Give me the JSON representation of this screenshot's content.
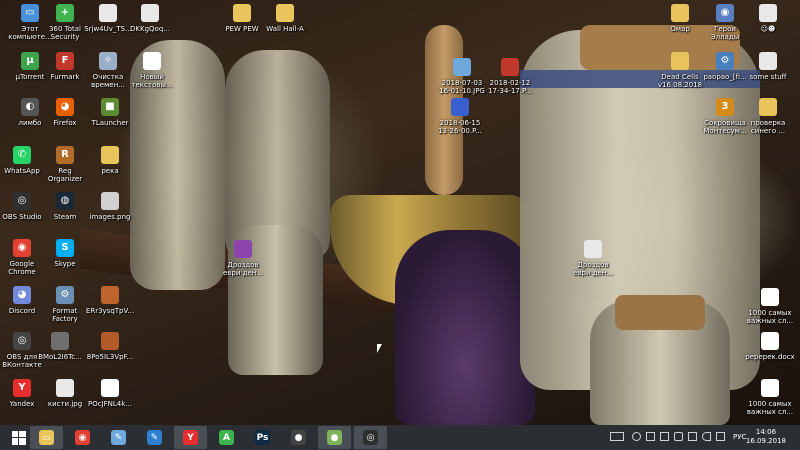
{
  "desktop_icons": [
    {
      "id": "computer",
      "label": "Этот\nкомпьюте...",
      "icon": "computer-icon",
      "color": "#4a90d9",
      "glyph": "▭"
    },
    {
      "id": "360",
      "label": "360 Total\nSecurity",
      "icon": "shield-icon",
      "color": "#3fb34f",
      "glyph": "+"
    },
    {
      "id": "srjw",
      "label": "Srjw4Uv_TS...",
      "icon": "document-icon",
      "color": "#e8e8e8",
      "glyph": ""
    },
    {
      "id": "dkkg",
      "label": "DKKgQoq...",
      "icon": "document-icon",
      "color": "#e8e8e8",
      "glyph": ""
    },
    {
      "id": "pewpew",
      "label": "PEW PEW",
      "icon": "folder-icon",
      "color": "#e8c45a",
      "glyph": ""
    },
    {
      "id": "wallhall",
      "label": "Wall Hall-A",
      "icon": "folder-icon",
      "color": "#e8c45a",
      "glyph": ""
    },
    {
      "id": "omar",
      "label": "Омар",
      "icon": "folder-icon",
      "color": "#e8c45a",
      "glyph": ""
    },
    {
      "id": "heroes",
      "label": "Герои\nЭллады",
      "icon": "game-icon",
      "color": "#5a7fc0",
      "glyph": "◉"
    },
    {
      "id": "smile",
      "label": "☺☻",
      "icon": "document-icon",
      "color": "#e8e8e8",
      "glyph": ""
    },
    {
      "id": "utorrent",
      "label": "µTorrent",
      "icon": "utorrent-icon",
      "color": "#3fa34d",
      "glyph": "µ"
    },
    {
      "id": "furmark",
      "label": "Furmark",
      "icon": "furmark-icon",
      "color": "#c0392b",
      "glyph": "F"
    },
    {
      "id": "cleaner",
      "label": "Очистка\nвремен...",
      "icon": "cleanup-icon",
      "color": "#9ab0c8",
      "glyph": "✧"
    },
    {
      "id": "newtext",
      "label": "Новый\nтекстовы...",
      "icon": "text-file-icon",
      "color": "#ffffff",
      "glyph": "≡"
    },
    {
      "id": "img0703",
      "label": "2018-07-03\n16-01-10.JPG",
      "icon": "image-icon",
      "color": "#6fa8dc",
      "glyph": ""
    },
    {
      "id": "img0212",
      "label": "2018-02-12\n17-34-17.P...",
      "icon": "image-icon",
      "color": "#c0392b",
      "glyph": ""
    },
    {
      "id": "deadcells",
      "label": "Dead Cells\nv16.08.2018",
      "icon": "folder-icon",
      "color": "#e8c45a",
      "glyph": ""
    },
    {
      "id": "raopao",
      "label": "раораo_[fi...",
      "icon": "app-icon",
      "color": "#4a7fbf",
      "glyph": "⚙"
    },
    {
      "id": "somestuff",
      "label": "some stuff",
      "icon": "document-icon",
      "color": "#e8e8e8",
      "glyph": ""
    },
    {
      "id": "limbo",
      "label": "лимбо",
      "icon": "game-icon",
      "color": "#555555",
      "glyph": "◐"
    },
    {
      "id": "firefox",
      "label": "Firefox",
      "icon": "firefox-icon",
      "color": "#e66000",
      "glyph": "◕"
    },
    {
      "id": "tlauncher",
      "label": "TLauncher",
      "icon": "minecraft-icon",
      "color": "#5b8c32",
      "glyph": "■"
    },
    {
      "id": "img0615",
      "label": "2018-06-15\n13-26-00.P...",
      "icon": "image-icon",
      "color": "#3a5fcf",
      "glyph": ""
    },
    {
      "id": "treasures",
      "label": "Сокровища\nМонтесум...",
      "icon": "game-icon",
      "color": "#d48b1a",
      "glyph": "3"
    },
    {
      "id": "check",
      "label": "проверка\nсинего ...",
      "icon": "folder-icon",
      "color": "#e8c45a",
      "glyph": ""
    },
    {
      "id": "whatsapp",
      "label": "WhatsApp",
      "icon": "whatsapp-icon",
      "color": "#25d366",
      "glyph": "✆"
    },
    {
      "id": "regorg",
      "label": "Reg\nOrganizer",
      "icon": "reg-organizer-icon",
      "color": "#b36b2a",
      "glyph": "R"
    },
    {
      "id": "reka",
      "label": "река",
      "icon": "folder-icon",
      "color": "#e8c45a",
      "glyph": ""
    },
    {
      "id": "obs",
      "label": "OBS Studio",
      "icon": "obs-icon",
      "color": "#303030",
      "glyph": "◎"
    },
    {
      "id": "steam",
      "label": "Steam",
      "icon": "steam-icon",
      "color": "#1b2838",
      "glyph": "◍"
    },
    {
      "id": "imagespng",
      "label": "images.png",
      "icon": "image-icon",
      "color": "#d0d0d0",
      "glyph": ""
    },
    {
      "id": "chrome",
      "label": "Google\nChrome",
      "icon": "chrome-icon",
      "color": "#e34133",
      "glyph": "◉"
    },
    {
      "id": "skype",
      "label": "Skype",
      "icon": "skype-icon",
      "color": "#00aff0",
      "glyph": "S"
    },
    {
      "id": "drozd1",
      "label": "Дроздов\nеври ден...",
      "icon": "image-icon",
      "color": "#8e44ad",
      "glyph": ""
    },
    {
      "id": "drozd2",
      "label": "Дроздов\nеври ден...",
      "icon": "document-icon",
      "color": "#e8e8e8",
      "glyph": ""
    },
    {
      "id": "discord",
      "label": "Discord",
      "icon": "discord-icon",
      "color": "#7289da",
      "glyph": "◕"
    },
    {
      "id": "ff",
      "label": "Format\nFactory",
      "icon": "format-factory-icon",
      "color": "#6a8fb5",
      "glyph": "⚙"
    },
    {
      "id": "err",
      "label": "ERr3ysqTpV...",
      "icon": "image-icon",
      "color": "#c0642f",
      "glyph": ""
    },
    {
      "id": "words1000a",
      "label": "1000 самых\nважных сл...",
      "icon": "document-icon",
      "color": "#ffffff",
      "glyph": ""
    },
    {
      "id": "obsvk",
      "label": "OBS для\nВКонтакте",
      "icon": "obs-icon",
      "color": "#444444",
      "glyph": "◎"
    },
    {
      "id": "bmol",
      "label": "BMoL2I6Tc...",
      "icon": "image-icon",
      "color": "#6f6f6f",
      "glyph": ""
    },
    {
      "id": "8po5",
      "label": "8Po5IL3VpF...",
      "icon": "image-icon",
      "color": "#b35a2a",
      "glyph": ""
    },
    {
      "id": "rpdocx",
      "label": "реререк.docx",
      "icon": "word-doc-icon",
      "color": "#ffffff",
      "glyph": ""
    },
    {
      "id": "yandex",
      "label": "Yandex",
      "icon": "yandex-icon",
      "color": "#e62e2e",
      "glyph": "Y"
    },
    {
      "id": "kisti",
      "label": "кисти.jpg",
      "icon": "image-icon",
      "color": "#e8e8e8",
      "glyph": ""
    },
    {
      "id": "pocj",
      "label": "POcJFNL4k...",
      "icon": "document-icon",
      "color": "#ffffff",
      "glyph": ""
    },
    {
      "id": "words1000b",
      "label": "1000 самых\nважных сл...",
      "icon": "document-icon",
      "color": "#ffffff",
      "glyph": ""
    }
  ],
  "taskbar": {
    "start_icon": "windows-start-icon",
    "pinned": [
      {
        "name": "explorer",
        "icon": "file-explorer-icon",
        "color": "#e8c45a",
        "glyph": "▭",
        "active": true
      },
      {
        "name": "chrome",
        "icon": "chrome-icon",
        "color": "#e34133",
        "glyph": "◉",
        "active": false
      },
      {
        "name": "paint",
        "icon": "paint-icon",
        "color": "#6fa8dc",
        "glyph": "✎",
        "active": false
      },
      {
        "name": "editor",
        "icon": "editor-icon",
        "color": "#2f7fd0",
        "glyph": "✎",
        "active": false
      },
      {
        "name": "yandex",
        "icon": "yandex-browser-icon",
        "color": "#e62e2e",
        "glyph": "Y",
        "active": true
      },
      {
        "name": "green-app",
        "icon": "green-a-icon",
        "color": "#3fb34f",
        "glyph": "A",
        "active": false
      },
      {
        "name": "photoshop",
        "icon": "photoshop-icon",
        "color": "#0d2b45",
        "glyph": "Ps",
        "active": false
      },
      {
        "name": "penguin",
        "icon": "penguin-icon",
        "color": "#444444",
        "glyph": "●",
        "active": false
      },
      {
        "name": "bird-game",
        "icon": "bird-game-icon",
        "color": "#7fb35a",
        "glyph": "●",
        "active": true
      },
      {
        "name": "obs",
        "icon": "obs-icon",
        "color": "#303030",
        "glyph": "◎",
        "active": true
      }
    ],
    "language": "РУС",
    "time": "14:06",
    "date": "16.09.2018"
  }
}
